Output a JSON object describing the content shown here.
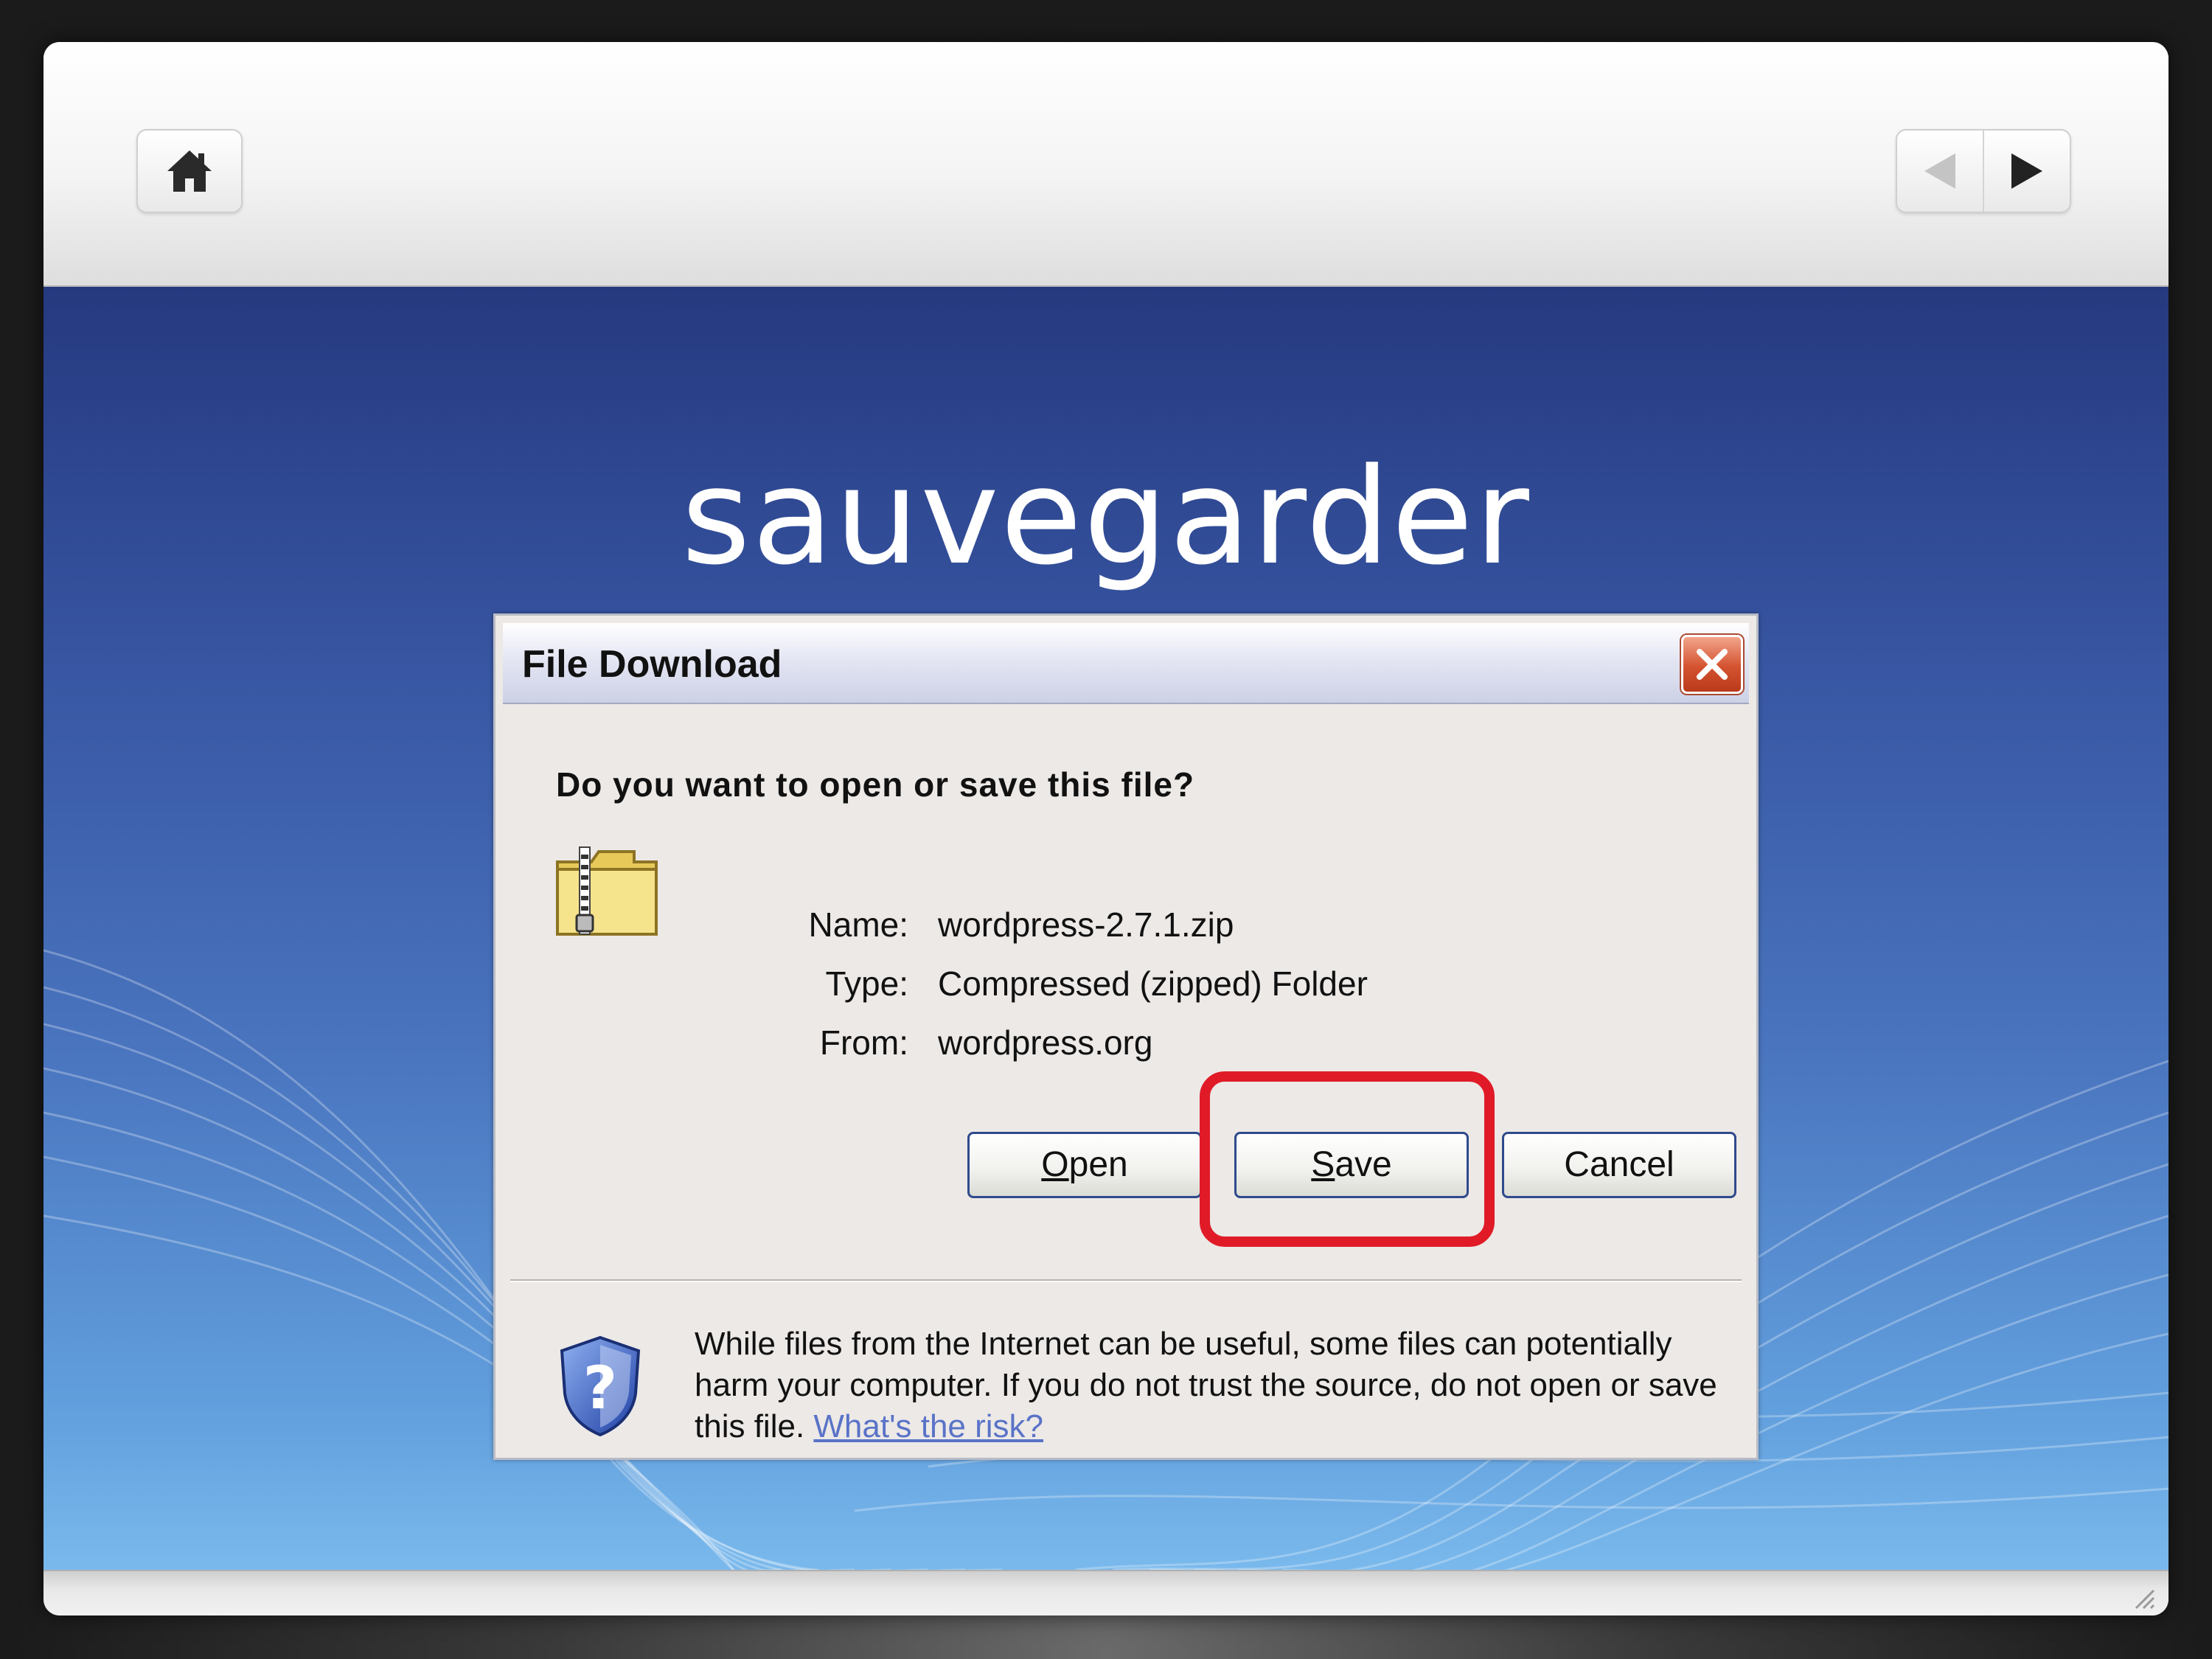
{
  "slide": {
    "title": "sauvegarder"
  },
  "toolbar": {
    "home_icon": "home-icon",
    "prev_icon": "triangle-left-icon",
    "next_icon": "triangle-right-icon"
  },
  "dialog": {
    "title": "File Download",
    "question": "Do you want to open or save this file?",
    "file_icon": "zip-folder-icon",
    "name_label": "Name:",
    "name_value": "wordpress-2.7.1.zip",
    "type_label": "Type:",
    "type_value": "Compressed (zipped) Folder",
    "from_label": "From:",
    "from_value": "wordpress.org",
    "buttons": {
      "open_mnemonic": "O",
      "open_rest": "pen",
      "save_mnemonic": "S",
      "save_rest": "ave",
      "cancel": "Cancel"
    },
    "warning_text": "While files from the Internet can be useful, some files can potentially harm your computer. If you do not trust the source, do not open or save this file.",
    "risk_link": "What's the risk?"
  },
  "colors": {
    "highlight": "#e01b27",
    "slide_title": "#ffffff",
    "link": "#5a73c8"
  }
}
